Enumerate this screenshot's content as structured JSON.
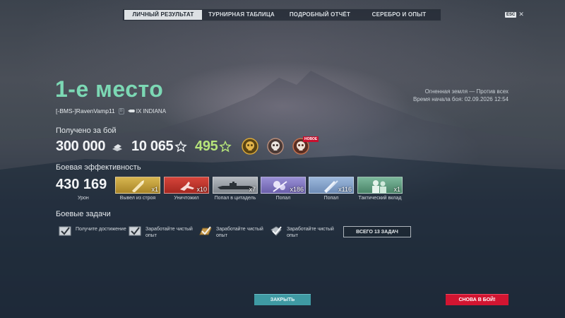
{
  "tabs": [
    {
      "label": "ЛИЧНЫЙ РЕЗУЛЬТАТ",
      "active": true
    },
    {
      "label": "ТУРНИРНАЯ ТАБЛИЦА",
      "active": false
    },
    {
      "label": "ПОДРОБНЫЙ ОТЧЁТ",
      "active": false
    },
    {
      "label": "СЕРЕБРО И ОПЫТ",
      "active": false
    }
  ],
  "esc": {
    "key": "ESC",
    "close": "✕"
  },
  "header": {
    "place": "1-е место",
    "player_name": "[-BMS-]RavenVamp11",
    "player_badge": "B",
    "ship": "IX INDIANA",
    "battle_mode": "Огненная земля — Против всех",
    "battle_start": "Время начала боя: 02.09.2026 12:54"
  },
  "earned": {
    "title": "Получено за бой",
    "credits": "300 000",
    "xp": "10 065",
    "free_xp": "495",
    "new_badge": "НОВОЕ"
  },
  "efficiency": {
    "title": "Боевая эффективность",
    "damage": "430 169",
    "damage_label": "Урон",
    "ribbons": [
      {
        "label": "Вывел из строя",
        "count": "x1",
        "color": "#c9a640",
        "icon": "shell-icon"
      },
      {
        "label": "Уничтожил",
        "count": "x10",
        "color": "#c8362d",
        "icon": "plane-destroyed-icon"
      },
      {
        "label": "Попал в цитадель",
        "count": "x7",
        "color": "#9da3aa",
        "icon": "citadel-ship-icon"
      },
      {
        "label": "Попал",
        "count": "x186",
        "color": "#7e74c0",
        "icon": "secondary-hit-icon"
      },
      {
        "label": "Попал",
        "count": "x116",
        "color": "#7c9bc4",
        "icon": "main-battery-hit-icon"
      },
      {
        "label": "Тактический вклад",
        "count": "x1",
        "color": "#5f9f83",
        "icon": "tactical-contribution-icon"
      }
    ]
  },
  "tasks": {
    "title": "Боевые задачи",
    "items": [
      {
        "text": "Получите достижение",
        "icon": "task-check-icon"
      },
      {
        "text": "Заработайте чистый опыт",
        "icon": "task-check-icon"
      },
      {
        "text": "Заработайте чистый опыт",
        "icon": "task-check-gold-icon"
      },
      {
        "text": "Заработайте чистый опыт",
        "icon": "task-check-diamond-icon"
      }
    ],
    "all_tasks_label": "ВСЕГО 13 ЗАДАЧ"
  },
  "buttons": {
    "close": "ЗАКРЫТЬ",
    "battle_again": "СНОВА В БОЙ!"
  },
  "colors": {
    "place_green": "#7cd8b4",
    "free_xp_green": "#b6e47a",
    "close_button": "#3f9aa3",
    "battle_button": "#d21531"
  }
}
